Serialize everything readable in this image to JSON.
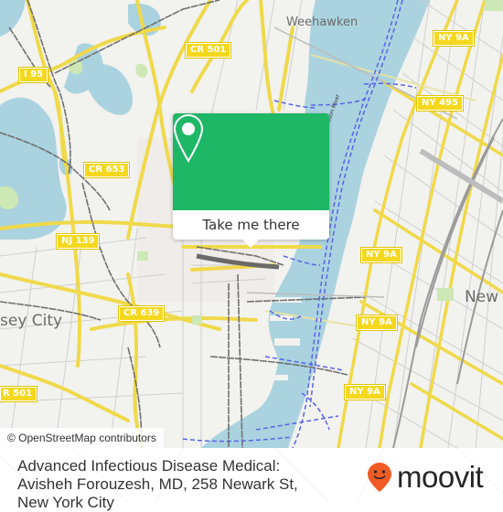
{
  "map": {
    "attribution": "© OpenStreetMap contributors",
    "colors": {
      "land": "#f2f2ef",
      "water": "#aad3df",
      "major_road": "#f7e262",
      "minor_road": "#c8c8c8",
      "rail": "#707070",
      "ferry": "#5560e8",
      "park": "#cde8b4"
    },
    "place_labels": [
      {
        "name": "Weehawken"
      },
      {
        "name": "sey City"
      },
      {
        "name": "New"
      }
    ],
    "route_shields": [
      {
        "label": "I 95"
      },
      {
        "label": "CR 501"
      },
      {
        "label": "CR 653"
      },
      {
        "label": "NJ 139"
      },
      {
        "label": "CR 639"
      },
      {
        "label": "R 501"
      },
      {
        "label": "NY 9A"
      },
      {
        "label": "NY 495"
      },
      {
        "label": "NY 9A"
      },
      {
        "label": "NY 9A"
      },
      {
        "label": "NY 9A"
      }
    ],
    "water_labels": [
      {
        "name": "Hudson River"
      }
    ]
  },
  "popup": {
    "icon": "map-pin-icon",
    "button_label": "Take me there",
    "accent_color": "#1db765"
  },
  "footer": {
    "title": "Advanced Infectious Disease Medical: Avisheh Forouzesh, MD, 258 Newark St, New York City",
    "logo_text": "moovit",
    "logo_icon": "moovit-pin-icon",
    "logo_color": "#f15a24"
  }
}
